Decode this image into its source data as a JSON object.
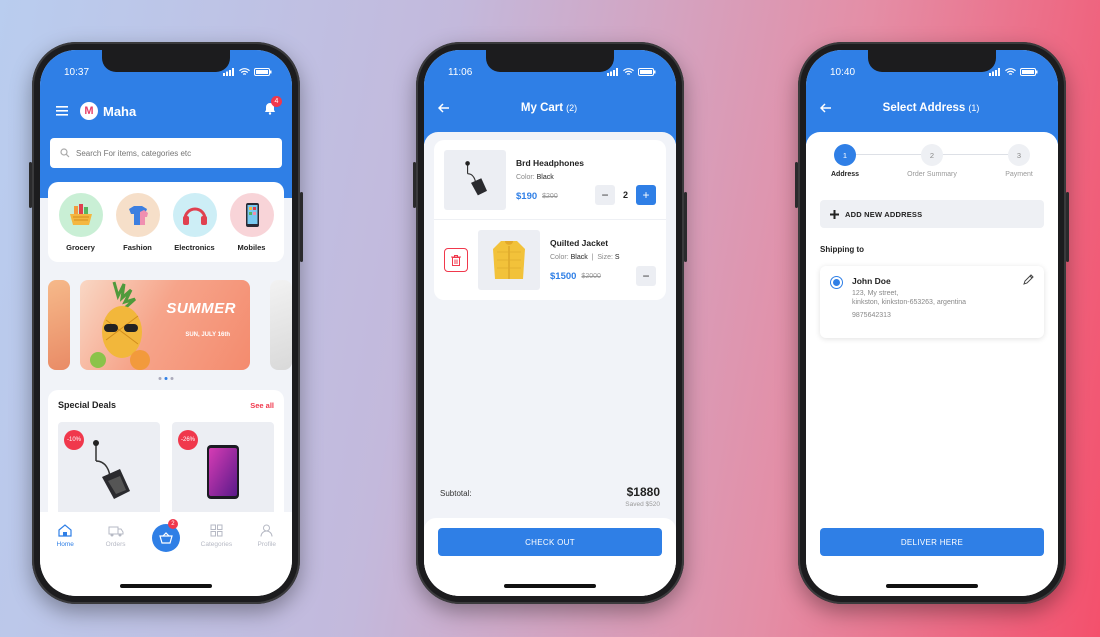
{
  "phone_home": {
    "time": "10:37",
    "brand": "Maha",
    "notification_count": "4",
    "search_placeholder": "Search For items, categories etc",
    "categories": [
      {
        "label": "Grocery",
        "bg": "#c9efd5"
      },
      {
        "label": "Fashion",
        "bg": "#f6dfc9"
      },
      {
        "label": "Electronics",
        "bg": "#cdeef6"
      },
      {
        "label": "Mobiles",
        "bg": "#f8d4d8"
      }
    ],
    "banner": {
      "title": "SUMMER",
      "subtitle": "SUN, JULY 16th"
    },
    "special_deals": {
      "title": "Special Deals",
      "see_all": "See all",
      "items": [
        {
          "discount": "-10%"
        },
        {
          "discount": "-26%"
        }
      ]
    },
    "tabs": [
      {
        "label": "Home",
        "icon": "home-icon"
      },
      {
        "label": "Orders",
        "icon": "orders-icon"
      },
      {
        "label": "Categories",
        "icon": "grid-icon"
      },
      {
        "label": "Profile",
        "icon": "profile-icon"
      }
    ],
    "cart_badge": "2"
  },
  "phone_cart": {
    "time": "11:06",
    "title": "My Cart",
    "count": "(2)",
    "items": [
      {
        "name": "Brd Headphones",
        "color_label": "Color:",
        "color": "Black",
        "price": "$190",
        "old_price": "$200",
        "qty": "2"
      },
      {
        "name": "Quilted Jacket",
        "color_label": "Color:",
        "color": "Black",
        "size_label": "Size:",
        "size": "S",
        "price": "$1500",
        "old_price": "$2000"
      }
    ],
    "subtotal_label": "Subtotal:",
    "subtotal": "$1880",
    "saved": "Saved $520",
    "checkout": "CHECK OUT"
  },
  "phone_address": {
    "time": "10:40",
    "title": "Select Address",
    "count": "(1)",
    "steps": [
      {
        "num": "1",
        "label": "Address"
      },
      {
        "num": "2",
        "label": "Order Summary"
      },
      {
        "num": "3",
        "label": "Payment"
      }
    ],
    "add_address": "ADD NEW ADDRESS",
    "shipping_to": "Shipping to",
    "address": {
      "name": "John Doe",
      "line1": "123, My street,",
      "line2": "kinkston, kinkston-653263, argentina",
      "phone": "9875642313"
    },
    "deliver": "DELIVER HERE"
  }
}
